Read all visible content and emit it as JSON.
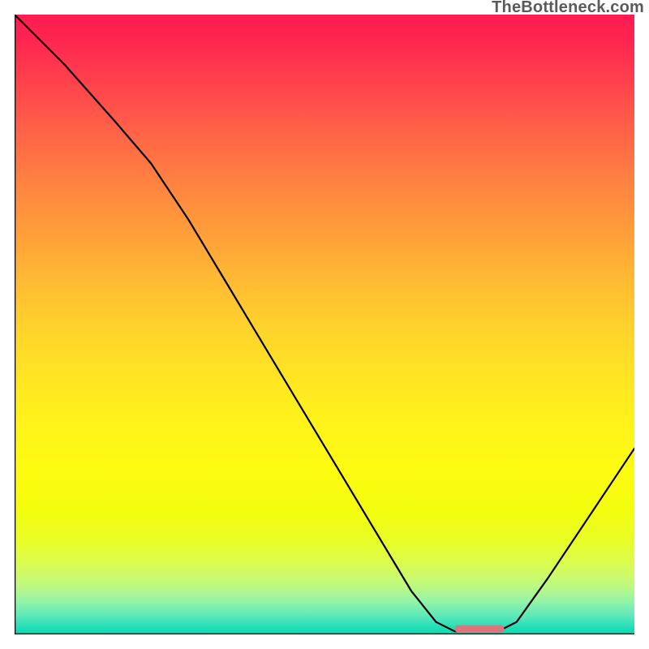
{
  "watermark": "TheBottleneck.com",
  "chart_data": {
    "type": "line",
    "title": "",
    "xlabel": "",
    "ylabel": "",
    "xlim": [
      0,
      100
    ],
    "ylim": [
      0,
      100
    ],
    "grid": false,
    "curve": [
      {
        "x": 0,
        "y": 100
      },
      {
        "x": 8,
        "y": 92
      },
      {
        "x": 16,
        "y": 83
      },
      {
        "x": 22,
        "y": 76
      },
      {
        "x": 28,
        "y": 67
      },
      {
        "x": 34,
        "y": 57
      },
      {
        "x": 40,
        "y": 47
      },
      {
        "x": 46,
        "y": 37
      },
      {
        "x": 52,
        "y": 27
      },
      {
        "x": 58,
        "y": 17
      },
      {
        "x": 64,
        "y": 7
      },
      {
        "x": 68,
        "y": 2
      },
      {
        "x": 71,
        "y": 0.5
      },
      {
        "x": 78,
        "y": 0.5
      },
      {
        "x": 81,
        "y": 2
      },
      {
        "x": 86,
        "y": 9
      },
      {
        "x": 92,
        "y": 18
      },
      {
        "x": 100,
        "y": 30
      }
    ],
    "marker": {
      "x_start": 71,
      "x_end": 79,
      "y": 0.9,
      "color": "#e4727c"
    },
    "background_gradient": {
      "stops": [
        {
          "pos": 0.0,
          "color": "#ff1c51"
        },
        {
          "pos": 0.5,
          "color": "#ffd12c"
        },
        {
          "pos": 0.74,
          "color": "#fdfc10"
        },
        {
          "pos": 1.0,
          "color": "#0ed9b1"
        }
      ]
    }
  }
}
